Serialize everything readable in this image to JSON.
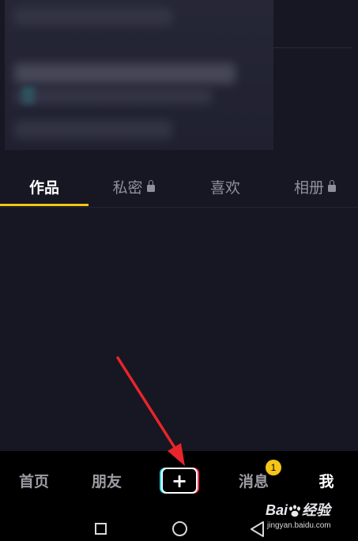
{
  "tabs": [
    {
      "label": "作品",
      "active": true,
      "locked": false
    },
    {
      "label": "私密",
      "active": false,
      "locked": true
    },
    {
      "label": "喜欢",
      "active": false,
      "locked": false
    },
    {
      "label": "相册",
      "active": false,
      "locked": true
    }
  ],
  "bottom_nav": {
    "home": "首页",
    "friends": "朋友",
    "create": "+",
    "messages": "消息",
    "messages_badge": "1",
    "me": "我"
  },
  "colors": {
    "background": "#161722",
    "accent": "#f5c518",
    "nav_background": "#000000",
    "create_cyan": "#26d9e8",
    "create_red": "#fe2c55",
    "annotation_arrow": "#e8252a"
  },
  "icons": {
    "tab_lock": "lock-icon",
    "system_recents": "square-icon",
    "system_home": "circle-icon",
    "system_back": "triangle-back-icon"
  },
  "watermark": {
    "logo": "Bai",
    "logo_suffix": "经验",
    "url": "jingyan.baidu.com"
  }
}
